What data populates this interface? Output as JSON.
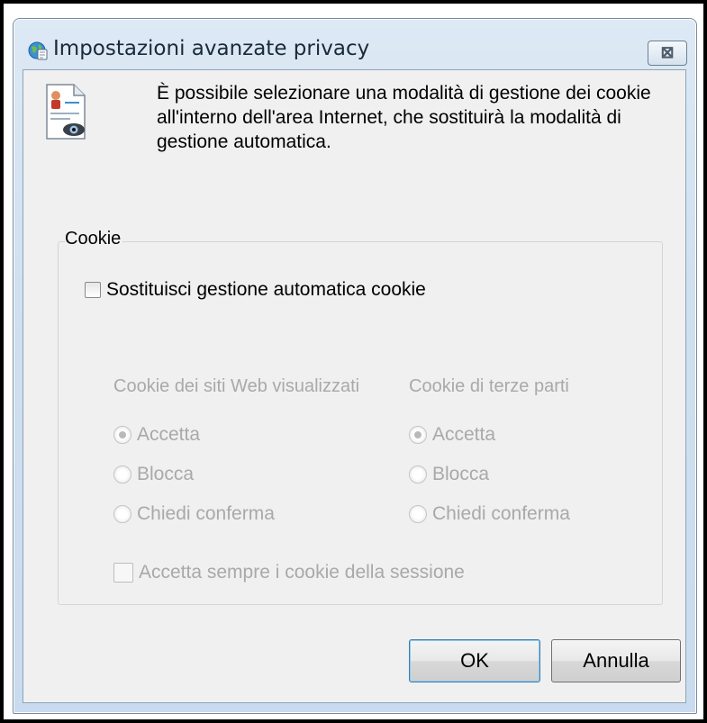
{
  "dialog": {
    "title": "Impostazioni avanzate privacy",
    "close_label": "⊠"
  },
  "intro": {
    "text": "È possibile selezionare una modalità di gestione dei cookie all'interno dell'area Internet, che sostituirà la modalità di gestione automatica."
  },
  "cookie_group": {
    "label": "Cookie",
    "override_checkbox": {
      "label": "Sostituisci gestione automatica cookie",
      "checked": false
    },
    "first_party": {
      "title": "Cookie dei siti Web visualizzati",
      "options": [
        "Accetta",
        "Blocca",
        "Chiedi conferma"
      ],
      "selected": "Accetta"
    },
    "third_party": {
      "title": "Cookie di terze parti",
      "options": [
        "Accetta",
        "Blocca",
        "Chiedi conferma"
      ],
      "selected": "Accetta"
    },
    "session_checkbox": {
      "label": "Accetta sempre i cookie della sessione",
      "checked": false
    }
  },
  "buttons": {
    "ok": "OK",
    "cancel": "Annulla"
  },
  "icons": {
    "title": "globe-privacy-icon",
    "document": "privacy-document-eye-icon"
  }
}
